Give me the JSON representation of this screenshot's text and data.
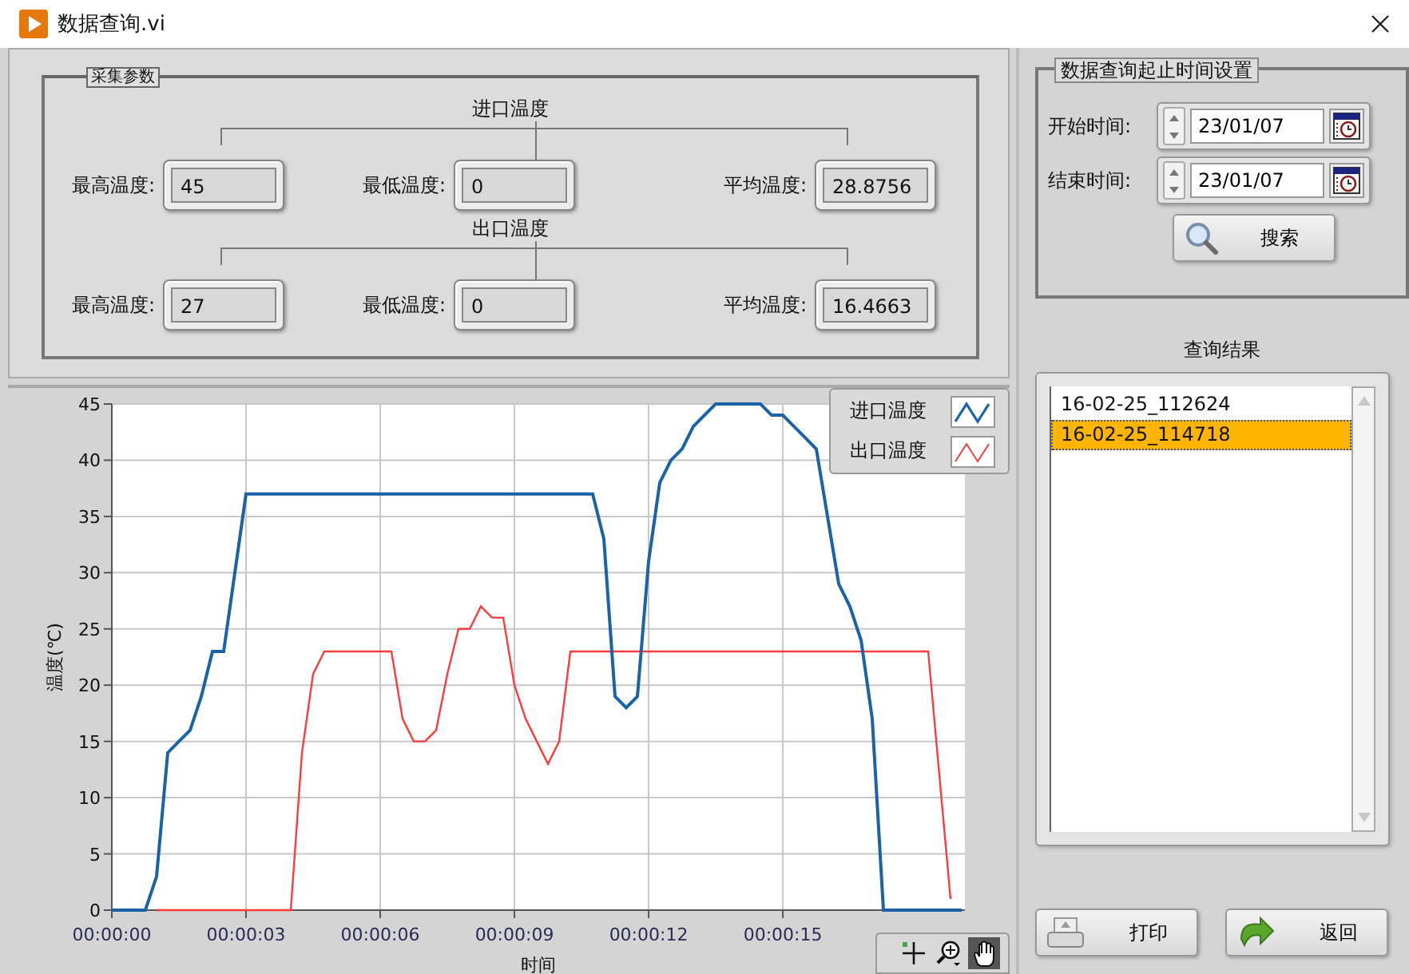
{
  "window": {
    "title": "数据查询.vi"
  },
  "parameters": {
    "title": "采集参数",
    "groups": [
      {
        "title": "进口温度",
        "fields": [
          {
            "label": "最高温度:",
            "value": "45"
          },
          {
            "label": "最低温度:",
            "value": "0"
          },
          {
            "label": "平均温度:",
            "value": "28.8756"
          }
        ]
      },
      {
        "title": "出口温度",
        "fields": [
          {
            "label": "最高温度:",
            "value": "27"
          },
          {
            "label": "最低温度:",
            "value": "0"
          },
          {
            "label": "平均温度:",
            "value": "16.4663"
          }
        ]
      }
    ]
  },
  "chart": {
    "chart_data": {
      "type": "line",
      "xlabel": "时间",
      "ylabel": "温度(℃)",
      "x": [
        0,
        0.25,
        0.5,
        0.75,
        1,
        1.25,
        1.5,
        1.75,
        2,
        2.25,
        2.5,
        2.75,
        3,
        3.25,
        3.5,
        3.75,
        4,
        4.25,
        4.5,
        4.75,
        5,
        5.25,
        5.5,
        5.75,
        6,
        6.25,
        6.5,
        6.75,
        7,
        7.25,
        7.5,
        7.75,
        8,
        8.25,
        8.5,
        8.75,
        9,
        9.25,
        9.5,
        9.75,
        10,
        10.25,
        10.5,
        10.75,
        11,
        11.25,
        11.5,
        11.75,
        12,
        12.25,
        12.5,
        12.75,
        13,
        13.25,
        13.5,
        13.75,
        14,
        14.25,
        14.5,
        14.75,
        15,
        15.25,
        15.5,
        15.75,
        16,
        16.25,
        16.5,
        16.75,
        17,
        17.25,
        17.5,
        17.75,
        18,
        18.25,
        18.5,
        18.75,
        19
      ],
      "series": [
        {
          "name": "进口温度",
          "color": "#1a63a8",
          "values": [
            0,
            0,
            0,
            0,
            3,
            14,
            15,
            16,
            19,
            23,
            23,
            30,
            37,
            37,
            37,
            37,
            37,
            37,
            37,
            37,
            37,
            37,
            37,
            37,
            37,
            37,
            37,
            37,
            37,
            37,
            37,
            37,
            37,
            37,
            37,
            37,
            37,
            37,
            37,
            37,
            37,
            37,
            37,
            37,
            33,
            19,
            18,
            19,
            31,
            38,
            40,
            41,
            43,
            44,
            45,
            45,
            45,
            45,
            45,
            44,
            44,
            43,
            42,
            41,
            35,
            29,
            27,
            24,
            17,
            0,
            0,
            0,
            0,
            0,
            0,
            0,
            0
          ]
        },
        {
          "name": "出口温度",
          "color": "#ff3b3b",
          "values": [
            null,
            null,
            null,
            null,
            0,
            0,
            0,
            0,
            0,
            0,
            0,
            0,
            0,
            0,
            0,
            0,
            0,
            14,
            21,
            23,
            23,
            23,
            23,
            23,
            23,
            23,
            17,
            15,
            15,
            16,
            21,
            25,
            25,
            27,
            26,
            26,
            20,
            17,
            15,
            13,
            15,
            23,
            23,
            23,
            23,
            23,
            23,
            23,
            23,
            23,
            23,
            23,
            23,
            23,
            23,
            23,
            23,
            23,
            23,
            23,
            23,
            23,
            23,
            23,
            23,
            23,
            23,
            23,
            23,
            23,
            23,
            23,
            23,
            23,
            12,
            1,
            null
          ]
        }
      ],
      "grid": true,
      "legend": true,
      "xlim": [
        0,
        19.07
      ],
      "ylim": [
        0,
        45
      ],
      "xticks": [
        {
          "value": 0,
          "label": "00:00:00"
        },
        {
          "value": 3,
          "label": "00:00:03"
        },
        {
          "value": 6,
          "label": "00:00:06"
        },
        {
          "value": 9,
          "label": "00:00:09"
        },
        {
          "value": 12,
          "label": "00:00:12"
        },
        {
          "value": 15,
          "label": "00:00:15"
        }
      ],
      "yticks": [
        0,
        5,
        10,
        15,
        20,
        25,
        30,
        35,
        40,
        45
      ]
    }
  },
  "query": {
    "title": "数据查询起止时间设置",
    "rows": [
      {
        "label": "开始时间:",
        "value": "23/01/07"
      },
      {
        "label": "结束时间:",
        "value": "23/01/07"
      }
    ],
    "search_button": "搜索"
  },
  "results": {
    "title": "查询结果",
    "items": [
      {
        "label": "16-02-25_112624",
        "selected": false
      },
      {
        "label": "16-02-25_114718",
        "selected": true
      }
    ]
  },
  "buttons": [
    {
      "label": "打印",
      "kind": "print"
    },
    {
      "label": "返回",
      "kind": "back"
    }
  ]
}
